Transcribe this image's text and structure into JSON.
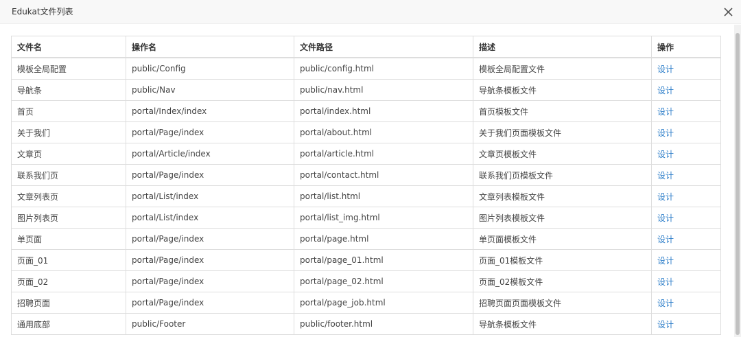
{
  "dialog": {
    "title": "Edukat文件列表"
  },
  "table": {
    "headers": [
      "文件名",
      "操作名",
      "文件路径",
      "描述",
      "操作"
    ],
    "rows": [
      {
        "name": "模板全局配置",
        "action": "public/Config",
        "path": "public/config.html",
        "desc": "模板全局配置文件",
        "op": "设计"
      },
      {
        "name": "导航条",
        "action": "public/Nav",
        "path": "public/nav.html",
        "desc": "导航条模板文件",
        "op": "设计"
      },
      {
        "name": "首页",
        "action": "portal/Index/index",
        "path": "portal/index.html",
        "desc": "首页模板文件",
        "op": "设计"
      },
      {
        "name": "关于我们",
        "action": "portal/Page/index",
        "path": "portal/about.html",
        "desc": "关于我们页面模板文件",
        "op": "设计"
      },
      {
        "name": "文章页",
        "action": "portal/Article/index",
        "path": "portal/article.html",
        "desc": "文章页模板文件",
        "op": "设计"
      },
      {
        "name": "联系我们页",
        "action": "portal/Page/index",
        "path": "portal/contact.html",
        "desc": "联系我们页模板文件",
        "op": "设计"
      },
      {
        "name": "文章列表页",
        "action": "portal/List/index",
        "path": "portal/list.html",
        "desc": "文章列表模板文件",
        "op": "设计"
      },
      {
        "name": "图片列表页",
        "action": "portal/List/index",
        "path": "portal/list_img.html",
        "desc": "图片列表模板文件",
        "op": "设计"
      },
      {
        "name": "单页面",
        "action": "portal/Page/index",
        "path": "portal/page.html",
        "desc": "单页面模板文件",
        "op": "设计"
      },
      {
        "name": "页面_01",
        "action": "portal/Page/index",
        "path": "portal/page_01.html",
        "desc": "页面_01模板文件",
        "op": "设计"
      },
      {
        "name": "页面_02",
        "action": "portal/Page/index",
        "path": "portal/page_02.html",
        "desc": "页面_02模板文件",
        "op": "设计"
      },
      {
        "name": "招聘页面",
        "action": "portal/Page/index",
        "path": "portal/page_job.html",
        "desc": "招聘页面页面模板文件",
        "op": "设计"
      },
      {
        "name": "通用底部",
        "action": "public/Footer",
        "path": "public/footer.html",
        "desc": "导航条模板文件",
        "op": "设计"
      }
    ]
  },
  "colors": {
    "link": "#2b7dc9",
    "border": "#dddddd",
    "titlebar_bg": "#f8f8f8"
  },
  "icons": {
    "close": "close-icon"
  }
}
